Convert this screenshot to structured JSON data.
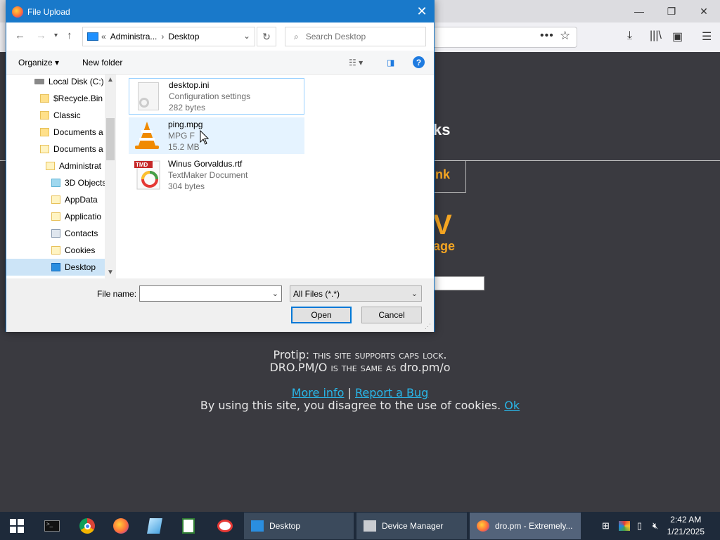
{
  "dialog": {
    "title": "File Upload",
    "address": {
      "parent": "Administra...",
      "current": "Desktop"
    },
    "search_placeholder": "Search Desktop",
    "toolbar": {
      "organize": "Organize ▾",
      "new_folder": "New folder",
      "help": "?"
    },
    "tree": [
      {
        "label": "Local Disk (C:)",
        "icon": "drive-icon"
      },
      {
        "label": "$Recycle.Bin",
        "icon": "folder-icon"
      },
      {
        "label": "Classic",
        "icon": "folder-icon"
      },
      {
        "label": "Documents a",
        "icon": "folder-icon"
      },
      {
        "label": "Documents a",
        "icon": "folder-icon"
      },
      {
        "label": "Administrat",
        "icon": "folder-icon"
      },
      {
        "label": "3D Objects",
        "icon": "3d-objects-icon"
      },
      {
        "label": "AppData",
        "icon": "folder-icon"
      },
      {
        "label": "Applicatio",
        "icon": "folder-icon"
      },
      {
        "label": "Contacts",
        "icon": "contacts-icon"
      },
      {
        "label": "Cookies",
        "icon": "folder-icon"
      },
      {
        "label": "Desktop",
        "icon": "desktop-icon",
        "selected": true
      }
    ],
    "files": [
      {
        "name": "desktop.ini",
        "type": "Configuration settings",
        "size": "282 bytes",
        "icon": "ini-file-icon"
      },
      {
        "name": "ping.mpg",
        "type": "MPG F",
        "size": "15.2 MB",
        "icon": "vlc-icon"
      },
      {
        "name": "Winus Gorvaldus.rtf",
        "type": "TextMaker Document",
        "size": "304 bytes",
        "icon": "textmaker-icon"
      }
    ],
    "file_name_label": "File name:",
    "file_name_value": "",
    "file_type": "All Files (*.*)",
    "open_label": "Open",
    "cancel_label": "Cancel"
  },
  "page": {
    "heading_fragment": "ks",
    "link_fragment": "nk",
    "big_fragment": "V",
    "big2_fragment": "age",
    "protip_prefix": "Protip: ",
    "protip_text": "this site supports caps lock.",
    "line2_a": "DRO.PM/O ",
    "line2_b": "is the same as",
    "line2_c": " dro.pm/o",
    "more_info": "More info",
    "pipe": " | ",
    "report_bug": "Report a Bug",
    "cookie_text": "By using this site, you disagree to the use of cookies. ",
    "ok": "Ok"
  },
  "taskbar": {
    "windows": [
      {
        "label": "Desktop",
        "icon": "explorer-icon"
      },
      {
        "label": "Device Manager",
        "icon": "device-manager-icon"
      },
      {
        "label": "dro.pm - Extremely...",
        "icon": "firefox-icon",
        "active": true
      }
    ],
    "time": "2:42 AM",
    "date": "1/21/2025"
  }
}
